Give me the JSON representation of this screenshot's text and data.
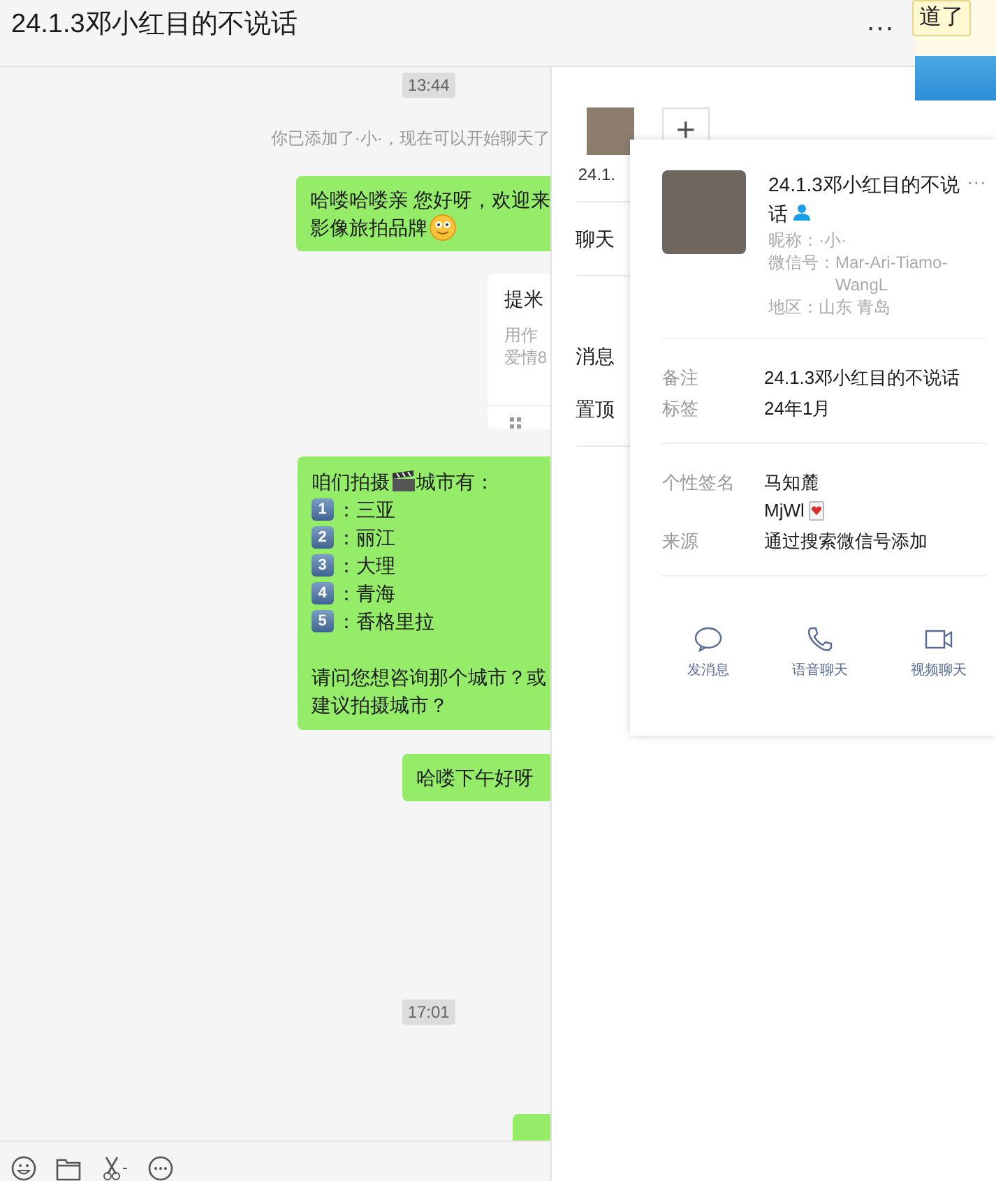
{
  "window": {
    "title": "24.1.3邓小红目的不说话",
    "more": "···"
  },
  "chat": {
    "items": [
      {
        "kind": "time",
        "text": "13:44"
      },
      {
        "kind": "system",
        "text": "你已添加了·小·，现在可以开始聊天了"
      },
      {
        "kind": "text",
        "lines": [
          "哈喽哈喽亲 您好呀，欢迎来",
          "影像旅拍品牌"
        ],
        "emoji": true
      },
      {
        "kind": "card",
        "title": "提米",
        "lines": [
          "用作",
          "爱情8"
        ]
      },
      {
        "kind": "cities",
        "intro": "咱们拍摄",
        "intro_after": "城市有：",
        "entries": [
          {
            "num": "1",
            "text": "：三亚"
          },
          {
            "num": "2",
            "text": "：丽江"
          },
          {
            "num": "3",
            "text": "：大理"
          },
          {
            "num": "4",
            "text": "：青海"
          },
          {
            "num": "5",
            "text": "：香格里拉"
          }
        ],
        "outro": [
          "请问您想咨询那个城市？或",
          "建议拍摄城市？"
        ]
      },
      {
        "kind": "text",
        "lines": [
          "哈喽下午好呀"
        ],
        "emoji": false
      },
      {
        "kind": "time",
        "text": "17:01"
      },
      {
        "kind": "stub"
      }
    ]
  },
  "side_panel": {
    "member_name": "24.1.",
    "add": "+",
    "rows": [
      {
        "label": "聊天",
        "divider": true
      },
      {
        "label": "消息",
        "divider": false
      },
      {
        "label": "置顶",
        "divider": true
      }
    ]
  },
  "background": {
    "button": "道了"
  },
  "profile": {
    "name": "24.1.3邓小红目的不说话",
    "more": "···",
    "details": [
      {
        "label": "昵称：",
        "value": "·小·"
      },
      {
        "label": "微信号：",
        "value": "Mar-Ari-Tiamo-WangL"
      },
      {
        "label": "地区：",
        "value": "山东 青岛"
      }
    ],
    "sections": [
      [
        {
          "label": "备注",
          "lines": [
            "24.1.3邓小红目的不说话"
          ]
        },
        {
          "label": "标签",
          "lines": [
            "24年1月"
          ]
        }
      ],
      [
        {
          "label": "个性签名",
          "lines": [
            "马知麓",
            "MjWl"
          ],
          "heart": true
        },
        {
          "label": "来源",
          "lines": [
            "通过搜索微信号添加"
          ]
        }
      ]
    ],
    "actions": [
      {
        "kind": "message",
        "label": "发消息"
      },
      {
        "kind": "voice",
        "label": "语音聊天"
      },
      {
        "kind": "video",
        "label": "视频聊天"
      }
    ]
  }
}
